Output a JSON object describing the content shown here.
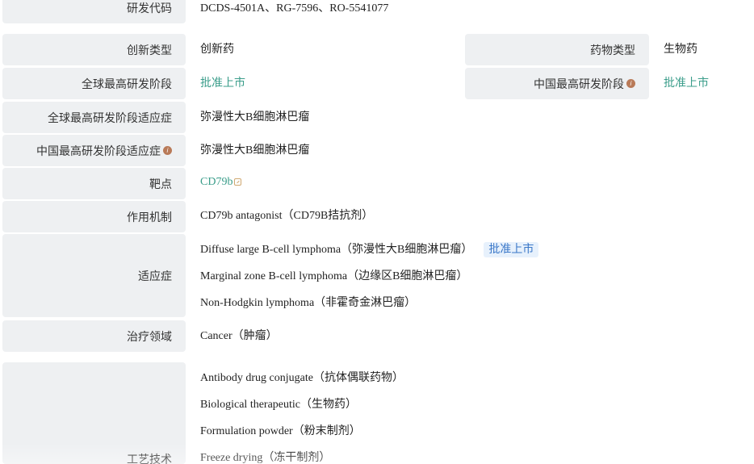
{
  "rows": {
    "rd_code": {
      "label": "研发代码",
      "value": "DCDS-4501A、RG-7596、RO-5541077"
    },
    "innovation_type": {
      "label": "创新类型",
      "value": "创新药"
    },
    "drug_type": {
      "label": "药物类型",
      "value": "生物药"
    },
    "global_phase": {
      "label": "全球最高研发阶段",
      "value": "批准上市"
    },
    "china_phase": {
      "label": "中国最高研发阶段",
      "value": "批准上市"
    },
    "global_indication": {
      "label": "全球最高研发阶段适应症",
      "value": "弥漫性大B细胞淋巴瘤"
    },
    "china_indication": {
      "label": "中国最高研发阶段适应症",
      "value": "弥漫性大B细胞淋巴瘤"
    },
    "target": {
      "label": "靶点",
      "value": "CD79b"
    },
    "mechanism": {
      "label": "作用机制",
      "value": "CD79b antagonist（CD79B拮抗剂）"
    },
    "indications": {
      "label": "适应症",
      "items": [
        "Diffuse large B-cell lymphoma（弥漫性大B细胞淋巴瘤）",
        "Marginal zone B-cell lymphoma（边缘区B细胞淋巴瘤）",
        "Non-Hodgkin lymphoma（非霍奇金淋巴瘤）"
      ],
      "badge": "批准上市"
    },
    "therapeutic_area": {
      "label": "治疗领域",
      "value": "Cancer（肿瘤）"
    },
    "technology": {
      "label": "工艺技术",
      "items": [
        "Antibody drug conjugate（抗体偶联药物）",
        "Biological therapeutic（生物药）",
        "Formulation powder（粉末制剂）",
        "Freeze drying（冻干制剂）"
      ]
    }
  },
  "icons": {
    "info": "info-icon",
    "external_link": "external-link-icon"
  },
  "colors": {
    "label_bg": "#eef0f2",
    "link": "#3a9d8a",
    "badge_bg": "#e7f1fc",
    "badge_text": "#3a77c8",
    "info_icon": "#b97a58"
  }
}
